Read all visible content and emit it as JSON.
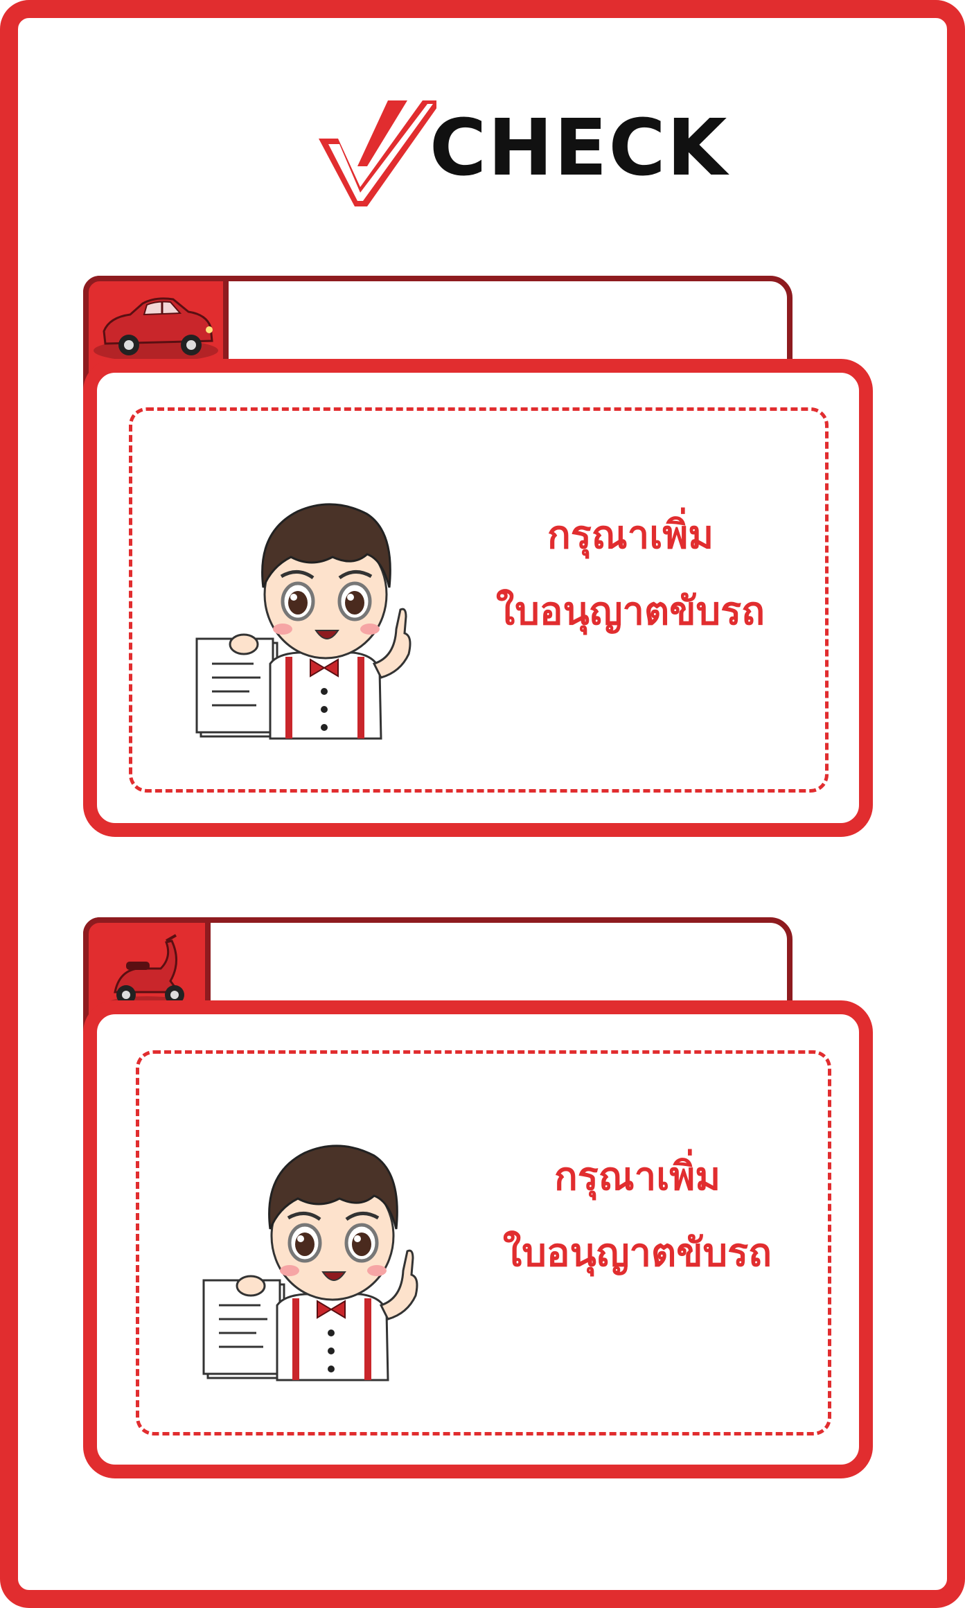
{
  "brand": {
    "logo_text": "CHECK",
    "accent_color": "#e12d2f",
    "dark_accent_color": "#8e1b1f"
  },
  "sections": [
    {
      "tab_icon": "car-icon",
      "message_line1": "กรุณาเพิ่ม",
      "message_line2": "ใบอนุญาตขับรถ",
      "mascot": "mascot-holding-document"
    },
    {
      "tab_icon": "scooter-icon",
      "message_line1": "กรุณาเพิ่ม",
      "message_line2": "ใบอนุญาตขับรถ",
      "mascot": "mascot-holding-document"
    }
  ]
}
